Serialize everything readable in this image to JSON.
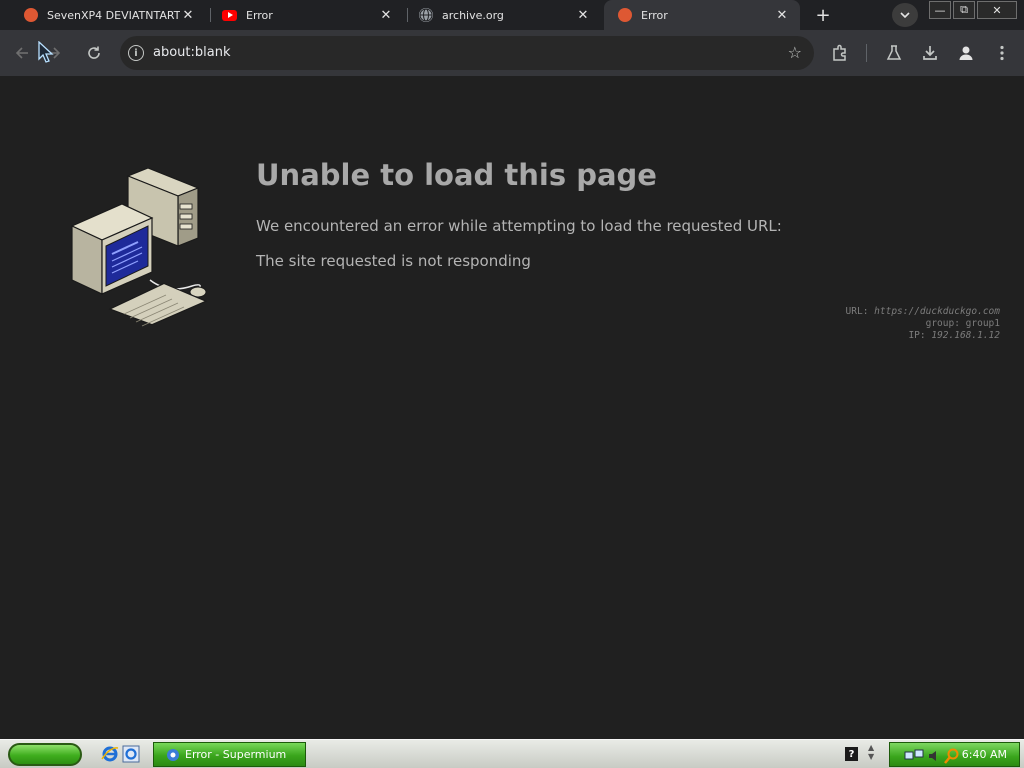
{
  "tabs": [
    {
      "title": "SevenXP4 DEVIATNTART - ",
      "favicon": "duckduckgo-icon",
      "active": false
    },
    {
      "title": "Error",
      "favicon": "youtube-icon",
      "active": false
    },
    {
      "title": "archive.org",
      "favicon": "globe-icon",
      "active": false
    },
    {
      "title": "Error",
      "favicon": "duckduckgo-icon",
      "active": true
    }
  ],
  "window_controls": {
    "minimize": "—",
    "restore": "⧉",
    "close": "✕"
  },
  "toolbar": {
    "url": "about:blank",
    "icons": [
      "back-icon",
      "forward-icon",
      "reload-icon",
      "site-info-icon",
      "bookmark-star-icon",
      "extensions-icon",
      "labs-icon",
      "download-icon",
      "profile-icon",
      "menu-icon"
    ]
  },
  "error_page": {
    "heading": "Unable to load this page",
    "message": "We encountered an error while attempting to load the requested URL:",
    "reason": "The site requested is not responding",
    "details": {
      "url_label": "URL:",
      "url_value": "https://duckduckgo.com",
      "group_label": "group:",
      "group_value": "group1",
      "ip_label": "IP:",
      "ip_value": "192.168.1.12"
    }
  },
  "taskbar": {
    "task_label": "Error - Supermium",
    "clock": "6:40 AM"
  },
  "colors": {
    "page_bg": "#202020",
    "heading": "#a8a8a8",
    "taskbar_green": "#3aa51c",
    "ddg_orange": "#de5833",
    "youtube_red": "#ff0000"
  }
}
